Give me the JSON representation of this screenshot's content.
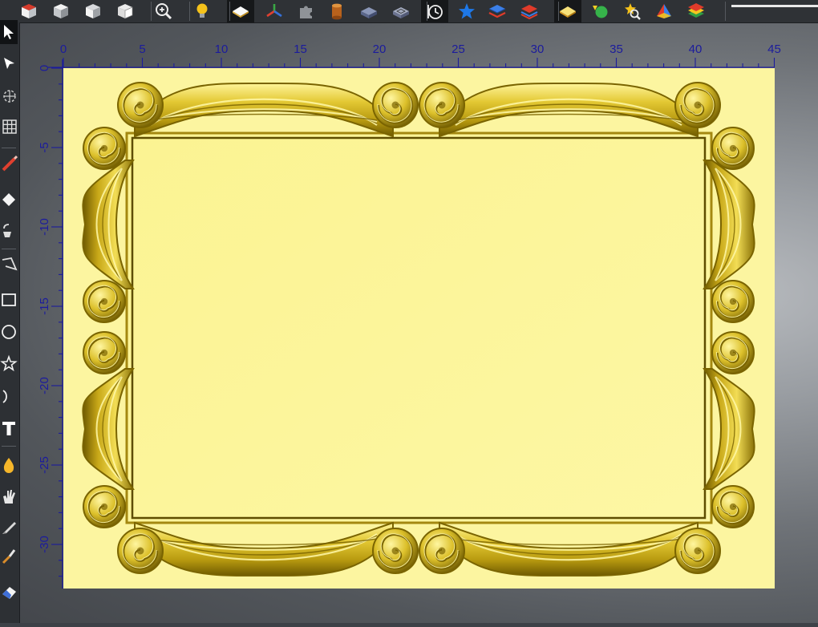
{
  "toolbar": {
    "items": [
      {
        "name": "cube-red-top-icon"
      },
      {
        "name": "cube-front-view-icon"
      },
      {
        "name": "cube-side-view-icon"
      },
      {
        "name": "cube-iso-view-icon"
      },
      {
        "name": "zoom-in-icon"
      },
      {
        "name": "lightbulb-icon"
      },
      {
        "name": "layer-white-icon",
        "active": true
      },
      {
        "name": "axes-icon"
      },
      {
        "name": "puzzle-icon"
      },
      {
        "name": "cylinder-icon"
      },
      {
        "name": "slab-blue-icon"
      },
      {
        "name": "slab-wire-icon"
      },
      {
        "name": "clock-toolpath-icon",
        "active": true
      },
      {
        "name": "star-blue-icon"
      },
      {
        "name": "layers-blue-red-icon"
      },
      {
        "name": "layers-red-icon"
      },
      {
        "name": "layer-yellow-icon",
        "active": true
      },
      {
        "name": "shapes-green-icon"
      },
      {
        "name": "zoom-selection-icon"
      },
      {
        "name": "pyramid-icon"
      },
      {
        "name": "stack-colors-icon"
      }
    ]
  },
  "left_toolbar": {
    "items": [
      {
        "name": "select-arrow-icon",
        "active": true
      },
      {
        "name": "node-edit-arrow-icon"
      },
      {
        "name": "transform-icon"
      },
      {
        "name": "grid-icon"
      },
      {
        "name": "pencil-red-icon"
      },
      {
        "name": "eraser-icon"
      },
      {
        "name": "bucket-icon"
      },
      {
        "name": "polyline-icon"
      },
      {
        "name": "rectangle-icon"
      },
      {
        "name": "circle-icon"
      },
      {
        "name": "star-icon"
      },
      {
        "name": "arc-icon"
      },
      {
        "name": "text-tool-icon"
      },
      {
        "name": "drop-icon"
      },
      {
        "name": "hand-icon"
      },
      {
        "name": "knife-icon"
      },
      {
        "name": "brush-icon"
      },
      {
        "name": "eraser-blue-icon"
      }
    ]
  },
  "ruler": {
    "x_labels": [
      "0",
      "5",
      "10",
      "15",
      "20",
      "25",
      "30",
      "35",
      "40",
      "45"
    ],
    "y_labels": [
      "0",
      "-5",
      "-10",
      "-15",
      "-20",
      "-25",
      "-30"
    ],
    "label_color": "#1c1c9c"
  },
  "canvas": {
    "background": "#fcf5a0",
    "frame_color": "#d9bf24",
    "frame_dark": "#7a6400",
    "frame_light": "#fff8a8"
  }
}
